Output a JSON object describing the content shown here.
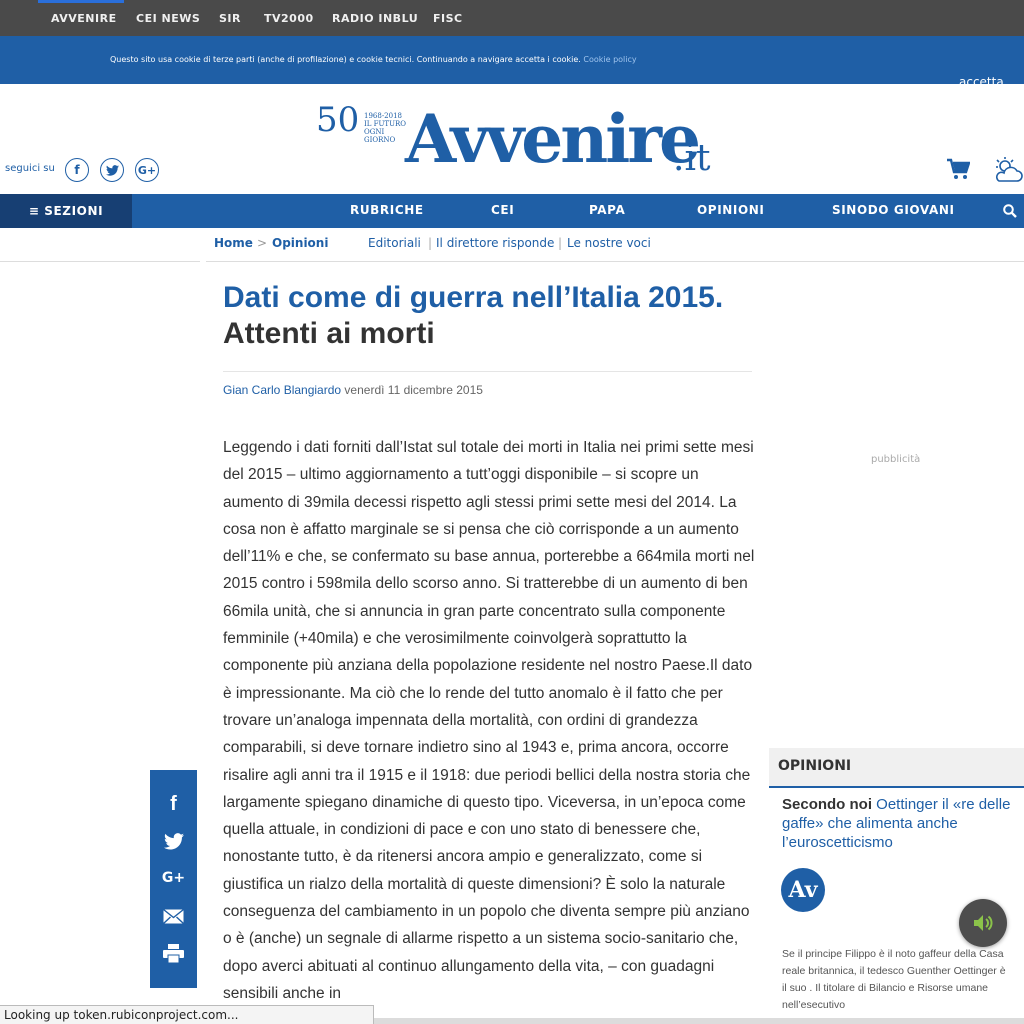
{
  "network": {
    "items": [
      "AVVENIRE",
      "CEI NEWS",
      "SIR",
      "TV2000",
      "RADIO INBLU",
      "FISC"
    ]
  },
  "cookie": {
    "text": "Questo sito usa cookie di terze parti (anche di profilazione) e cookie tecnici. Continuando a navigare accetta i cookie.",
    "link": "Cookie policy",
    "accept": "accetta"
  },
  "header": {
    "follow": "seguici su",
    "anniversary_number": "50",
    "anniversary_line1": "1968-2018",
    "anniversary_line2": "IL FUTURO",
    "anniversary_line3": "OGNI GIORNO",
    "logo_main": "Avvenire",
    "logo_tld": ".it"
  },
  "nav": {
    "sections": "≡ SEZIONI",
    "items": [
      "RUBRICHE",
      "CEI",
      "PAPA",
      "OPINIONI",
      "SINODO GIOVANI"
    ]
  },
  "breadcrumb": {
    "home": "Home",
    "sep": ">",
    "current": "Opinioni",
    "links": [
      "Editoriali",
      "|",
      "Il direttore risponde",
      "|",
      "Le nostre voci"
    ]
  },
  "article": {
    "title_blue": "Dati come di guerra nell’Italia 2015.",
    "title_dark": "Attenti ai morti",
    "author": "Gian Carlo Blangiardo",
    "date": "venerdì 11 dicembre 2015",
    "body": "Leggendo i dati forniti dall’Istat sul totale dei morti in Italia nei primi sette mesi del 2015 – ultimo aggiornamento a tutt’oggi disponibile – si scopre un aumento di 39mila decessi rispetto agli stessi primi sette mesi del 2014. La cosa non è affatto marginale se si pensa che ciò corrisponde a un aumento dell’11% e che, se confermato su base annua, porterebbe a 664mila morti nel 2015 contro i 598mila dello scorso anno. Si tratterebbe di un aumento di ben 66mila unità, che si annuncia in gran parte concentrato sulla componente femminile (+40mila) e che verosimilmente coinvolgerà soprattutto la componente più anziana della popolazione residente nel nostro Paese.Il dato è impressionante. Ma ciò che lo rende del tutto anomalo è il fatto che per trovare un’analoga impennata della mortalità, con ordini di grandezza comparabili, si deve tornare indietro sino al 1943 e, prima ancora, occorre risalire agli anni tra il 1915 e il 1918: due periodi bellici della nostra storia che largamente spiegano dinamiche di questo tipo. Viceversa, in un’epoca come quella attuale, in condizioni di pace e con uno stato di benessere che, nonostante tutto, è da ritenersi ancora ampio e generalizzato, come si giustifica un rialzo della mortalità di queste dimensioni? È solo la naturale conseguenza del cambiamento in un popolo che diventa sempre più anziano o è (anche) un segnale di allarme rispetto a un sistema socio-sanitario che, dopo averci abituati al continuo allungamento della vita, – con guadagni sensibili anche in"
  },
  "ad": {
    "label": "pubblicità"
  },
  "sidebar": {
    "heading": "OPINIONI",
    "kicker": "Secondo noi",
    "headline": " Oettinger il «re delle gaffe» che alimenta anche l’euroscetticismo",
    "avatar": "Av",
    "excerpt": "Se il principe Filippo è il noto gaffeur della Casa reale britannica, il tedesco Guenther Oettinger è il suo . Il titolare di Bilancio e Risorse umane nell’esecutivo"
  },
  "status_bar": {
    "text": "Looking up token.rubiconproject.com..."
  },
  "colors": {
    "brand": "#1f5fa6",
    "brand_dark": "#173f73",
    "topbar": "#4a4a4a"
  },
  "icons": [
    "facebook-icon",
    "twitter-icon",
    "google-plus-icon",
    "cart-icon",
    "weather-icon",
    "search-icon",
    "email-icon",
    "print-icon",
    "speaker-icon"
  ]
}
